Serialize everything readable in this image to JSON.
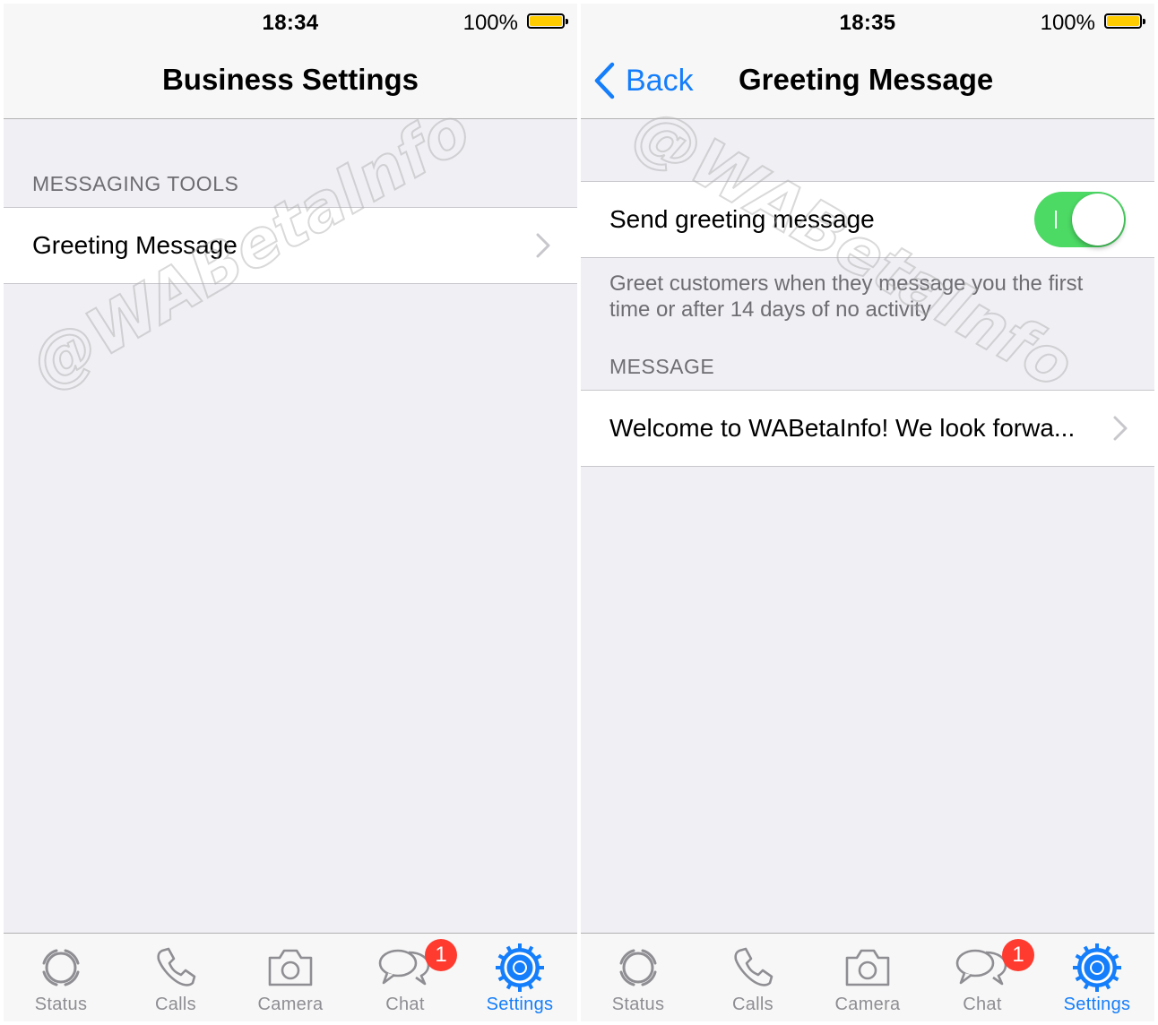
{
  "left_screen": {
    "status_bar": {
      "time": "18:34",
      "battery_percent": "100%"
    },
    "nav": {
      "title": "Business Settings"
    },
    "sections": [
      {
        "header": "MESSAGING TOOLS",
        "rows": [
          {
            "label": "Greeting Message",
            "accessory": "chevron-right"
          }
        ]
      }
    ],
    "watermark": "@WABetaInfo"
  },
  "right_screen": {
    "status_bar": {
      "time": "18:35",
      "battery_percent": "100%"
    },
    "nav": {
      "back_label": "Back",
      "title": "Greeting Message"
    },
    "toggle_row": {
      "label": "Send greeting message",
      "enabled": true
    },
    "toggle_footer": "Greet customers when they message you the first time or after 14 days of no activity",
    "message_section": {
      "header": "MESSAGE",
      "value": "Welcome to WABetaInfo! We look forwa..."
    },
    "watermark": "@WABetaInfo"
  },
  "tab_bar": {
    "items": [
      {
        "label": "Status",
        "icon": "status-icon"
      },
      {
        "label": "Calls",
        "icon": "phone-icon"
      },
      {
        "label": "Camera",
        "icon": "camera-icon"
      },
      {
        "label": "Chat",
        "icon": "chat-bubbles-icon",
        "badge": "1"
      },
      {
        "label": "Settings",
        "icon": "gear-icon",
        "active": true
      }
    ]
  },
  "colors": {
    "accent": "#157efb",
    "toggle_on": "#4cd964",
    "badge": "#ff3b30",
    "battery": "#ffcc00",
    "background": "#efeff4",
    "bar": "#f7f7f7"
  }
}
